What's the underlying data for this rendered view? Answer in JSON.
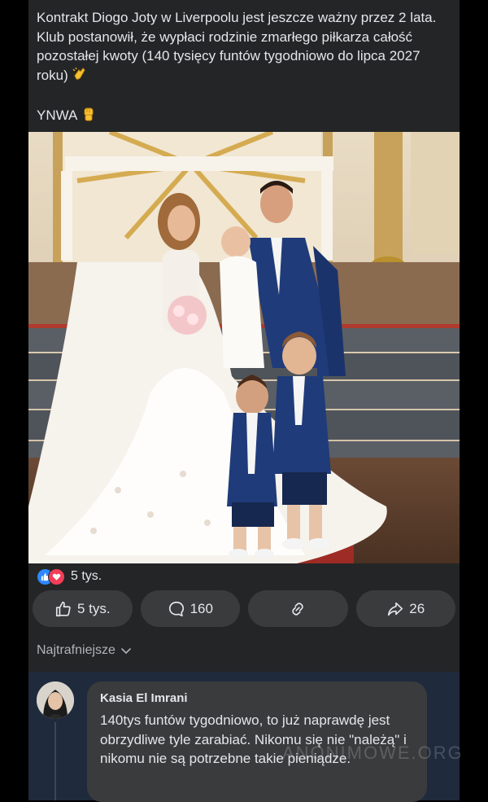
{
  "post": {
    "text": "Kontrakt Diogo Joty w Liverpoolu jest jeszcze ważny przez 2 lata. Klub postanowił, że wypłaci rodzinie zmarłego piłkarza całość pozostałej kwoty (140 tysięcy funtów tygodniowo do lipca 2027 roku)",
    "text_emoji": "clapping-hands",
    "ynwa": "YNWA",
    "ynwa_emoji": "raised-fist",
    "photo_alt": "wedding-family-photo"
  },
  "reactions": {
    "count": "5 tys.",
    "icons": [
      "like-icon",
      "love-icon"
    ]
  },
  "actions": {
    "like": "5 tys.",
    "comment": "160",
    "share_link": "",
    "share": "26"
  },
  "sort": {
    "label": "Najtrafniejsze"
  },
  "comment": {
    "author": "Kasia El Imrani",
    "text": "140tys funtów tygodniowo, to już naprawdę jest obrzydliwe tyle zarabiać. Nikomu się nie \"należą\" i nikomu nie są potrzebne takie pieniądze.",
    "watermark": "ANONIMOWE.ORG"
  },
  "colors": {
    "background": "#000000",
    "post_bg": "#242526",
    "button_bg": "#3a3b3c",
    "like_blue": "#2d88ff",
    "love_red": "#f33e58",
    "comment_area": "#1f2a3c"
  }
}
